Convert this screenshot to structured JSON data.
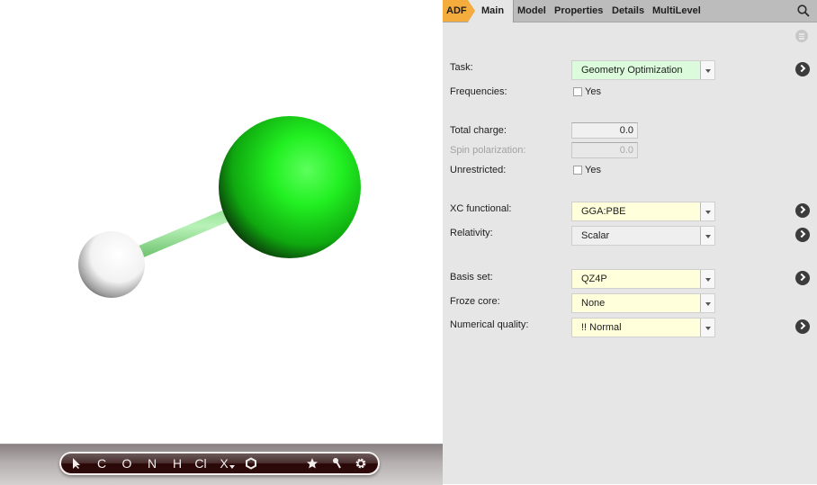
{
  "viewer": {
    "molecule": {
      "atoms": [
        {
          "element": "H",
          "color": "#ffffff"
        },
        {
          "element": "Cl",
          "color": "#1ef01e"
        }
      ],
      "bond_color": "#8fe08f"
    },
    "toolbar": {
      "select_tool": "select-arrow-icon",
      "elements": [
        "C",
        "O",
        "N",
        "H",
        "Cl"
      ],
      "other_element": "X",
      "ring_tool": "hexagon-icon",
      "favorites": "star-icon",
      "tools": "wrench-icon",
      "settings": "gear-icon"
    }
  },
  "panel": {
    "tabs": {
      "engine": "ADF",
      "active": "Main",
      "items": [
        "Model",
        "Properties",
        "Details",
        "MultiLevel"
      ]
    },
    "accent_color": "#f4ad3c",
    "fields": {
      "task": {
        "label": "Task:",
        "value": "Geometry Optimization"
      },
      "frequencies": {
        "label": "Frequencies:",
        "option": "Yes",
        "checked": false
      },
      "total_charge": {
        "label": "Total charge:",
        "value": "0.0"
      },
      "spin_polarization": {
        "label": "Spin polarization:",
        "value": "0.0",
        "disabled": true
      },
      "unrestricted": {
        "label": "Unrestricted:",
        "option": "Yes",
        "checked": false
      },
      "xc_functional": {
        "label": "XC functional:",
        "value": "GGA:PBE"
      },
      "relativity": {
        "label": "Relativity:",
        "value": "Scalar"
      },
      "basis_set": {
        "label": "Basis set:",
        "value": "QZ4P"
      },
      "frozen_core": {
        "label": "Froze core:",
        "value": "None"
      },
      "numerical_quality": {
        "label": "Numerical quality:",
        "value": "!! Normal"
      }
    }
  }
}
